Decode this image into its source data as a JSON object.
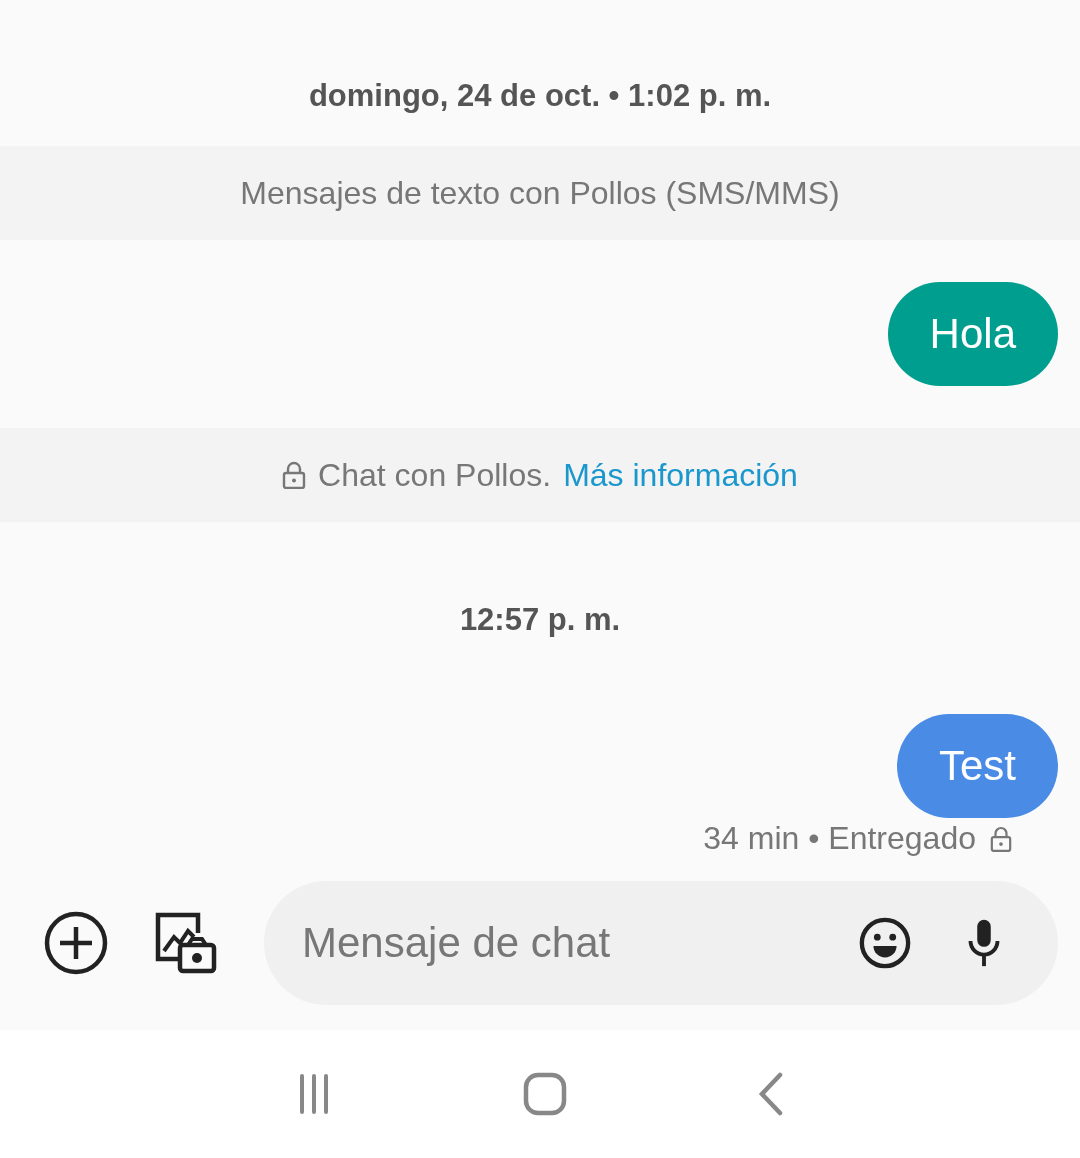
{
  "messages": [
    {
      "kind": "timestamp",
      "text": "domingo, 24 de oct. • 1:02 p. m."
    },
    {
      "kind": "banner",
      "text": "Mensajes de texto con Pollos (SMS/MMS)"
    },
    {
      "kind": "bubble",
      "text": "Hola",
      "color": "#009e8e"
    },
    {
      "kind": "info",
      "text": "Chat con Pollos.",
      "link": "Más información"
    },
    {
      "kind": "timestamp",
      "text": "12:57 p. m."
    },
    {
      "kind": "bubble",
      "text": "Test",
      "color": "#4a8be6"
    },
    {
      "kind": "status",
      "text": "34 min • Entregado"
    }
  ],
  "composer": {
    "placeholder": "Mensaje de chat"
  }
}
